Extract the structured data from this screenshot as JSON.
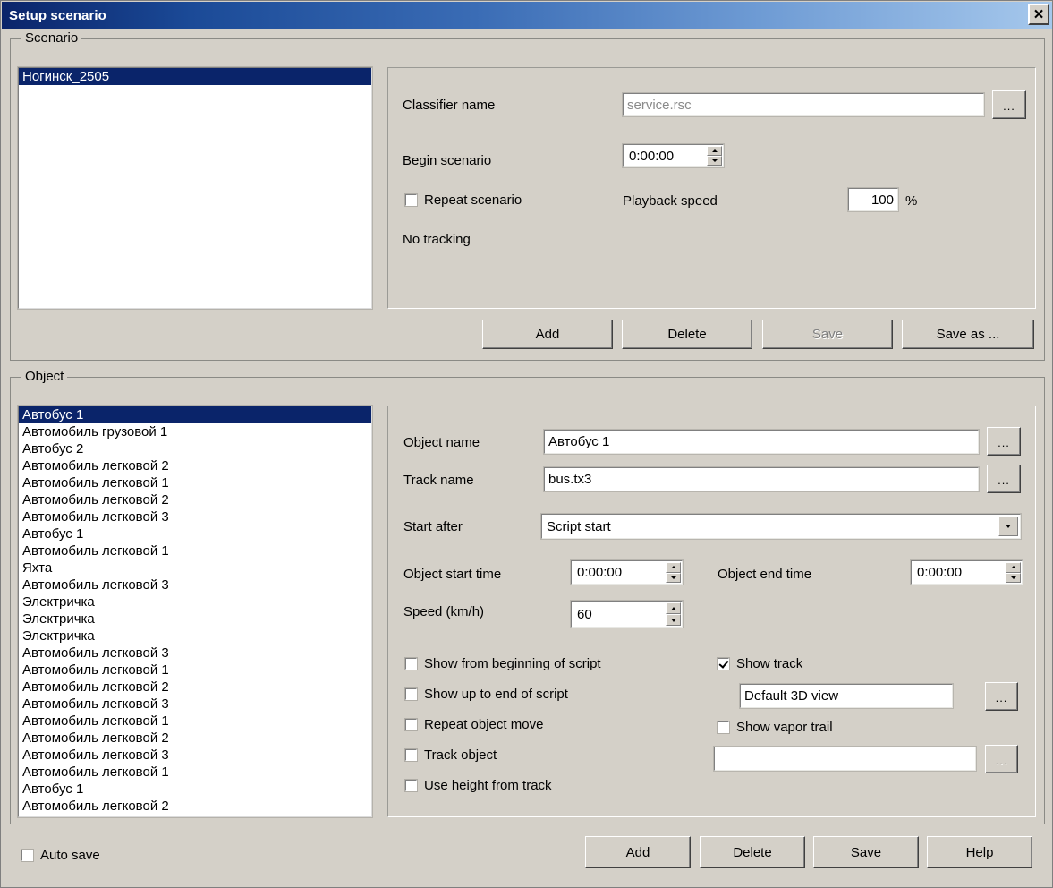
{
  "window": {
    "title": "Setup scenario",
    "close_label": "×"
  },
  "scenario_group": {
    "legend": "Scenario",
    "list": {
      "items": [
        {
          "label": "Ногинск_2505",
          "selected": true
        }
      ]
    },
    "fields": {
      "classifier_name_label": "Classifier name",
      "classifier_name_value": "service.rsc",
      "classifier_browse_label": "...",
      "begin_scenario_label": "Begin scenario",
      "begin_scenario_value": "0:00:00",
      "repeat_scenario_label": "Repeat scenario",
      "repeat_scenario_checked": false,
      "playback_speed_label": "Playback speed",
      "playback_speed_value": "100",
      "playback_speed_unit": "%",
      "tracking_status": "No tracking"
    },
    "buttons": {
      "add": "Add",
      "delete": "Delete",
      "save": "Save",
      "save_disabled": true,
      "save_as": "Save as ..."
    }
  },
  "object_group": {
    "legend": "Object",
    "list": {
      "items": [
        {
          "label": "Автобус 1",
          "selected": true
        },
        {
          "label": "Автомобиль грузовой 1",
          "selected": false
        },
        {
          "label": "Автобус 2",
          "selected": false
        },
        {
          "label": "Автомобиль легковой 2",
          "selected": false
        },
        {
          "label": "Автомобиль легковой 1",
          "selected": false
        },
        {
          "label": "Автомобиль легковой 2",
          "selected": false
        },
        {
          "label": "Автомобиль легковой 3",
          "selected": false
        },
        {
          "label": "Автобус 1",
          "selected": false
        },
        {
          "label": "Автомобиль легковой 1",
          "selected": false
        },
        {
          "label": "Яхта",
          "selected": false
        },
        {
          "label": "Автомобиль легковой 3",
          "selected": false
        },
        {
          "label": "Электричка",
          "selected": false
        },
        {
          "label": "Электричка",
          "selected": false
        },
        {
          "label": "Электричка",
          "selected": false
        },
        {
          "label": "Автомобиль легковой 3",
          "selected": false
        },
        {
          "label": "Автомобиль легковой 1",
          "selected": false
        },
        {
          "label": "Автомобиль легковой 2",
          "selected": false
        },
        {
          "label": "Автомобиль легковой 3",
          "selected": false
        },
        {
          "label": "Автомобиль легковой 1",
          "selected": false
        },
        {
          "label": "Автомобиль легковой 2",
          "selected": false
        },
        {
          "label": "Автомобиль легковой 3",
          "selected": false
        },
        {
          "label": "Автомобиль легковой 1",
          "selected": false
        },
        {
          "label": "Автобус 1",
          "selected": false
        },
        {
          "label": "Автомобиль легковой 2",
          "selected": false
        }
      ]
    },
    "fields": {
      "object_name_label": "Object name",
      "object_name_value": "Автобус 1",
      "object_name_browse_label": "...",
      "track_name_label": "Track name",
      "track_name_value": "bus.tx3",
      "track_name_browse_label": "...",
      "start_after_label": "Start after",
      "start_after_value": "Script start",
      "object_start_time_label": "Object start time",
      "object_start_time_value": "0:00:00",
      "object_end_time_label": "Object end time",
      "object_end_time_value": "0:00:00",
      "speed_label": "Speed (km/h)",
      "speed_value": "60"
    },
    "checkboxes": {
      "show_from_beginning": {
        "label": "Show from beginning of script",
        "checked": false
      },
      "show_up_to_end": {
        "label": "Show up to end of script",
        "checked": false
      },
      "repeat_object_move": {
        "label": "Repeat object move",
        "checked": false
      },
      "track_object": {
        "label": "Track object",
        "checked": false
      },
      "use_height_from_track": {
        "label": "Use height from track",
        "checked": false
      },
      "show_track": {
        "label": "Show track",
        "checked": true
      },
      "show_vapor_trail": {
        "label": "Show vapor trail",
        "checked": false
      }
    },
    "view_field": {
      "value": "Default 3D view",
      "browse_label": "..."
    },
    "vapor_field": {
      "value": "",
      "browse_label": "...",
      "browse_disabled": true
    }
  },
  "footer": {
    "auto_save_label": "Auto save",
    "auto_save_checked": false,
    "buttons": {
      "add": "Add",
      "delete": "Delete",
      "save": "Save",
      "help": "Help"
    }
  }
}
